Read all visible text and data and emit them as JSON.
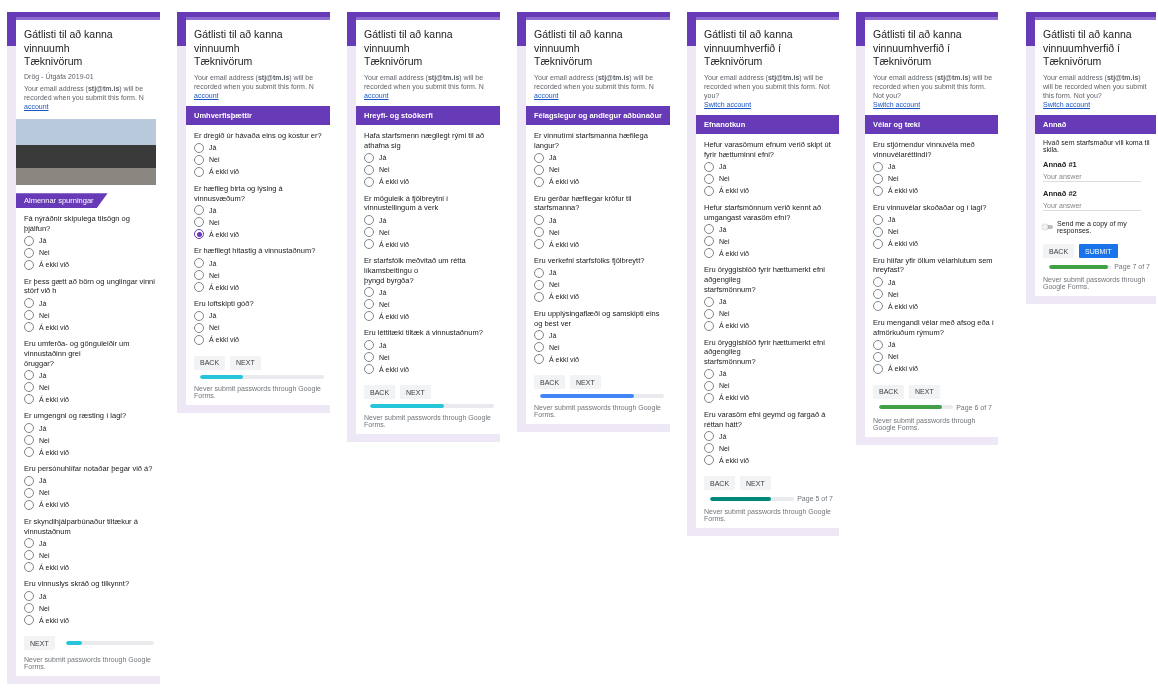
{
  "panels": [
    {
      "title_lines": [
        "Gátlisti til að kanna vinnuumh",
        "Tæknivörum"
      ],
      "subtitle": "Drög - Útgáfa 2019-01",
      "email": {
        "text": "Your email address (**stj@tm.is**) will be recorded when you submit this form. N",
        "link": "account"
      },
      "photo": true,
      "section": {
        "title": "Almennar spurningar",
        "kind": "tag"
      },
      "questions": [
        {
          "kind": "radio",
          "lines": [
            "Fá nýráðnir skipulega tilsögn og þjálfun?"
          ],
          "options": [
            {
              "label": "Já",
              "selected": false
            },
            {
              "label": "Nei",
              "selected": false
            },
            {
              "label": "Á ekki við",
              "selected": false
            }
          ]
        },
        {
          "kind": "radio",
          "lines": [
            "Er þess gætt að börn og unglingar vinni störf við h"
          ],
          "options": [
            {
              "label": "Já",
              "selected": false
            },
            {
              "label": "Nei",
              "selected": false
            },
            {
              "label": "Á ekki við",
              "selected": false
            }
          ]
        },
        {
          "kind": "radio",
          "lines": [
            "Eru umferða- og gönguleiðir um vinnustaðinn grei",
            "öruggar?"
          ],
          "options": [
            {
              "label": "Já",
              "selected": false
            },
            {
              "label": "Nei",
              "selected": false
            },
            {
              "label": "Á ekki við",
              "selected": false
            }
          ]
        },
        {
          "kind": "radio",
          "lines": [
            "Er umgengni og ræsting í lagi?"
          ],
          "options": [
            {
              "label": "Já",
              "selected": false
            },
            {
              "label": "Nei",
              "selected": false
            },
            {
              "label": "Á ekki við",
              "selected": false
            }
          ]
        },
        {
          "kind": "radio",
          "lines": [
            "Eru persónuhlífar notaðar þegar við á?"
          ],
          "options": [
            {
              "label": "Já",
              "selected": false
            },
            {
              "label": "Nei",
              "selected": false
            },
            {
              "label": "Á ekki við",
              "selected": false
            }
          ]
        },
        {
          "kind": "radio",
          "lines": [
            "Er skyndihjálparbúnaður tiltækur á vinnustaðnum"
          ],
          "options": [
            {
              "label": "Já",
              "selected": false
            },
            {
              "label": "Nei",
              "selected": false
            },
            {
              "label": "Á ekki við",
              "selected": false
            }
          ]
        },
        {
          "kind": "radio",
          "lines": [
            "Eru vinnuslys skráð og tilkynnt?"
          ],
          "options": [
            {
              "label": "Já",
              "selected": false
            },
            {
              "label": "Nei",
              "selected": false
            },
            {
              "label": "Á ekki við",
              "selected": false
            }
          ]
        }
      ],
      "buttons": [
        {
          "label": "NEXT",
          "kind": "plain"
        }
      ],
      "progress": {
        "level": 0.19,
        "color": "#26c6da"
      },
      "footer_note": "Never submit passwords through Google Forms."
    },
    {
      "title_lines": [
        "Gátlisti til að kanna vinnuumh",
        "Tæknivörum"
      ],
      "email": {
        "text": "Your email address (**stj@tm.is**) will be recorded when you submit this form. N",
        "link": "account"
      },
      "section": {
        "title": "Umhverfisþættir",
        "kind": "banner"
      },
      "questions": [
        {
          "kind": "radio",
          "lines": [
            "Er dregið úr hávaða eins og kostur er?"
          ],
          "options": [
            {
              "label": "Já",
              "selected": false
            },
            {
              "label": "Nei",
              "selected": false
            },
            {
              "label": "Á ekki við",
              "selected": false
            }
          ]
        },
        {
          "kind": "radio",
          "lines": [
            "Er hæfileg birta og lýsing á vinnusvæðum?"
          ],
          "options": [
            {
              "label": "Já",
              "selected": false
            },
            {
              "label": "Nei",
              "selected": false
            },
            {
              "label": "Á ekki við",
              "selected": true
            }
          ]
        },
        {
          "kind": "radio",
          "lines": [
            "Er hæfilegt hitastig á vinnustaðnum?"
          ],
          "options": [
            {
              "label": "Já",
              "selected": false
            },
            {
              "label": "Nei",
              "selected": false
            },
            {
              "label": "Á ekki við",
              "selected": false
            }
          ]
        },
        {
          "kind": "radio",
          "lines": [
            "Eru loftskipti góð?"
          ],
          "options": [
            {
              "label": "Já",
              "selected": false
            },
            {
              "label": "Nei",
              "selected": false
            },
            {
              "label": "Á ekki við",
              "selected": false
            }
          ]
        }
      ],
      "buttons": [
        {
          "label": "BACK",
          "kind": "plain"
        },
        {
          "label": "NEXT",
          "kind": "plain"
        }
      ],
      "progress": {
        "level": 0.35,
        "color": "#26c6da"
      },
      "footer_note": "Never submit passwords through Google Forms."
    },
    {
      "title_lines": [
        "Gátlisti til að kanna vinnuumh",
        "Tæknivörum"
      ],
      "email": {
        "text": "Your email address (**stj@tm.is**) will be recorded when you submit this form. N",
        "link": "account"
      },
      "section": {
        "title": "Hreyfi- og stoðkerfi",
        "kind": "banner"
      },
      "questions": [
        {
          "kind": "radio",
          "lines": [
            "Hafa starfsmenn nægilegt rými til að athafna sig"
          ],
          "options": [
            {
              "label": "Já",
              "selected": false
            },
            {
              "label": "Nei",
              "selected": false
            },
            {
              "label": "Á ekki við",
              "selected": false
            }
          ]
        },
        {
          "kind": "radio",
          "lines": [
            "Er möguleik á fjölbreytni í vinnustellingum á verk"
          ],
          "options": [
            {
              "label": "Já",
              "selected": false
            },
            {
              "label": "Nei",
              "selected": false
            },
            {
              "label": "Á ekki við",
              "selected": false
            }
          ]
        },
        {
          "kind": "radio",
          "lines": [
            "Er starfsfólk meðvitað um rétta líkamsbeitingu o",
            "þyngd byrgða?"
          ],
          "options": [
            {
              "label": "Já",
              "selected": false
            },
            {
              "label": "Nei",
              "selected": false
            },
            {
              "label": "Á ekki við",
              "selected": false
            }
          ]
        },
        {
          "kind": "radio",
          "lines": [
            "Eru léttitæki tiltæk á vinnustaðnum?"
          ],
          "options": [
            {
              "label": "Já",
              "selected": false
            },
            {
              "label": "Nei",
              "selected": false
            },
            {
              "label": "Á ekki við",
              "selected": false
            }
          ]
        }
      ],
      "buttons": [
        {
          "label": "BACK",
          "kind": "plain"
        },
        {
          "label": "NEXT",
          "kind": "plain"
        }
      ],
      "progress": {
        "level": 0.6,
        "color": "#26c6da"
      },
      "footer_note": "Never submit passwords through Google Forms."
    },
    {
      "title_lines": [
        "Gátlisti til að kanna vinnuumh",
        "Tæknivörum"
      ],
      "email": {
        "text": "Your email address (**stj@tm.is**) will be recorded when you submit this form. N",
        "link": "account"
      },
      "section": {
        "title": "Félagslegur og andlegur aðbúnaður",
        "kind": "banner"
      },
      "questions": [
        {
          "kind": "radio",
          "lines": [
            "Er vinnutími starfsmanna hæfilega langur?"
          ],
          "options": [
            {
              "label": "Já",
              "selected": false
            },
            {
              "label": "Nei",
              "selected": false
            },
            {
              "label": "Á ekki við",
              "selected": false
            }
          ]
        },
        {
          "kind": "radio",
          "lines": [
            "Eru gerðar hæfilegar kröfur til starfsmanna?"
          ],
          "options": [
            {
              "label": "Já",
              "selected": false
            },
            {
              "label": "Nei",
              "selected": false
            },
            {
              "label": "Á ekki við",
              "selected": false
            }
          ]
        },
        {
          "kind": "radio",
          "lines": [
            "Eru verkefni starfsfólks fjölbreytt?"
          ],
          "options": [
            {
              "label": "Já",
              "selected": false
            },
            {
              "label": "Nei",
              "selected": false
            },
            {
              "label": "Á ekki við",
              "selected": false
            }
          ]
        },
        {
          "kind": "radio",
          "lines": [
            "Eru upplýsingaflæði og samskipti eins og best ver"
          ],
          "options": [
            {
              "label": "Já",
              "selected": false
            },
            {
              "label": "Nei",
              "selected": false
            },
            {
              "label": "Á ekki við",
              "selected": false
            }
          ]
        }
      ],
      "buttons": [
        {
          "label": "BACK",
          "kind": "plain"
        },
        {
          "label": "NEXT",
          "kind": "plain"
        }
      ],
      "progress": {
        "level": 0.76,
        "color": "#4285f4"
      },
      "footer_note": "Never submit passwords through Google Forms."
    },
    {
      "title_lines": [
        "Gátlisti til að kanna vinnuumhverfið í",
        "Tæknivörum"
      ],
      "email": {
        "text": "Your email address (**stj@tm.is**) will be recorded when you submit this form. Not you?",
        "link": "Switch account"
      },
      "section": {
        "title": "Efnanotkun",
        "kind": "banner"
      },
      "questions": [
        {
          "kind": "radio",
          "lines": [
            "Hefur varasömum efnum verið skipt út fyrir hættuminni efni?"
          ],
          "options": [
            {
              "label": "Já",
              "selected": false
            },
            {
              "label": "Nei",
              "selected": false
            },
            {
              "label": "Á ekki við",
              "selected": false
            }
          ]
        },
        {
          "kind": "radio",
          "lines": [
            "Hefur starfsmönnum verið kennt að umgangast varasöm efni?"
          ],
          "options": [
            {
              "label": "Já",
              "selected": false
            },
            {
              "label": "Nei",
              "selected": false
            },
            {
              "label": "Á ekki við",
              "selected": false
            }
          ]
        },
        {
          "kind": "radio",
          "lines": [
            "Eru öryggisblöð fyrir hættumerkt efni aðgengileg",
            "starfsmönnum?"
          ],
          "options": [
            {
              "label": "Já",
              "selected": false
            },
            {
              "label": "Nei",
              "selected": false
            },
            {
              "label": "Á ekki við",
              "selected": false
            }
          ]
        },
        {
          "kind": "radio",
          "lines": [
            "Eru öryggisblöð fyrir hættumerkt efni aðgengileg",
            "starfsmönnum?"
          ],
          "options": [
            {
              "label": "Já",
              "selected": false
            },
            {
              "label": "Nei",
              "selected": false
            },
            {
              "label": "Á ekki við",
              "selected": false
            }
          ]
        },
        {
          "kind": "radio",
          "lines": [
            "Eru varasöm efni geymd og fargað á réttan hátt?"
          ],
          "options": [
            {
              "label": "Já",
              "selected": false
            },
            {
              "label": "Nei",
              "selected": false
            },
            {
              "label": "Á ekki við",
              "selected": false
            }
          ]
        }
      ],
      "buttons": [
        {
          "label": "BACK",
          "kind": "plain"
        },
        {
          "label": "NEXT",
          "kind": "plain"
        }
      ],
      "progress": {
        "level": 0.72,
        "color": "#00897b",
        "label": "Page 5 of 7"
      },
      "footer_note": "Never submit passwords through Google Forms."
    },
    {
      "title_lines": [
        "Gátlisti til að kanna vinnuumhverfið í",
        "Tæknivörum"
      ],
      "email": {
        "text": "Your email address (**stj@tm.is**) will be recorded when you submit this form. Not you?",
        "link": "Switch account"
      },
      "section": {
        "title": "Vélar og tæki",
        "kind": "banner"
      },
      "questions": [
        {
          "kind": "radio",
          "lines": [
            "Eru stjórnendur vinnuvéla með vinnuvélaréttindi?"
          ],
          "options": [
            {
              "label": "Já",
              "selected": false
            },
            {
              "label": "Nei",
              "selected": false
            },
            {
              "label": "Á ekki við",
              "selected": false
            }
          ]
        },
        {
          "kind": "radio",
          "lines": [
            "Eru vinnuvélar skoðaðar og í lagi?"
          ],
          "options": [
            {
              "label": "Já",
              "selected": false
            },
            {
              "label": "Nei",
              "selected": false
            },
            {
              "label": "Á ekki við",
              "selected": false
            }
          ]
        },
        {
          "kind": "radio",
          "lines": [
            "Eru hlífar yfir öllum vélarhlutum sem hreyfast?"
          ],
          "options": [
            {
              "label": "Já",
              "selected": false
            },
            {
              "label": "Nei",
              "selected": false
            },
            {
              "label": "Á ekki við",
              "selected": false
            }
          ]
        },
        {
          "kind": "radio",
          "lines": [
            "Eru mengandi vélar með afsog eða í afmörkuðum rýmum?"
          ],
          "options": [
            {
              "label": "Já",
              "selected": false
            },
            {
              "label": "Nei",
              "selected": false
            },
            {
              "label": "Á ekki við",
              "selected": false
            }
          ]
        }
      ],
      "buttons": [
        {
          "label": "BACK",
          "kind": "plain"
        },
        {
          "label": "NEXT",
          "kind": "plain"
        }
      ],
      "progress": {
        "level": 0.85,
        "color": "#43a047",
        "label": "Page 6 of 7"
      },
      "footer_note": "Never submit passwords through Google Forms."
    },
    {
      "title_lines": [
        "Gátlisti til að kanna vinnuumhverfið í",
        "Tæknivörum"
      ],
      "email": {
        "text": "Your email address (**stj@tm.is**) will be recorded when you submit this form. Not you?",
        "link": "Switch account"
      },
      "section": {
        "title": "Annað",
        "kind": "banner"
      },
      "description": "Hvað sem starfsmaður vill koma til skila.",
      "questions": [
        {
          "kind": "text",
          "lines": [
            "Annað #1"
          ],
          "placeholder": "Your answer"
        },
        {
          "kind": "text",
          "lines": [
            "Annað #2"
          ],
          "placeholder": "Your answer"
        }
      ],
      "copy_toggle": {
        "label": "Send me a copy of my responses.",
        "on": false
      },
      "buttons": [
        {
          "label": "BACK",
          "kind": "plain"
        },
        {
          "label": "SUBMIT",
          "kind": "primary"
        }
      ],
      "progress": {
        "level": 0.95,
        "color": "#43a047",
        "label": "Page 7 of 7"
      },
      "footer_note": "Never submit passwords through Google Forms."
    }
  ]
}
